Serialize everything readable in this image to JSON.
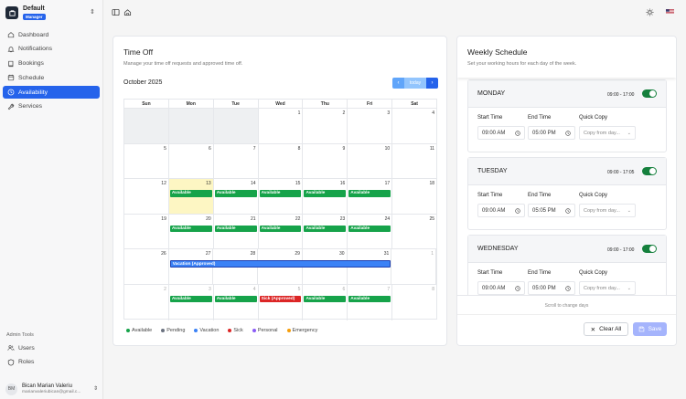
{
  "brand": {
    "name": "Default",
    "badge": "Manager"
  },
  "nav": [
    {
      "label": "Dashboard",
      "icon": "home-icon"
    },
    {
      "label": "Notifications",
      "icon": "bell-icon"
    },
    {
      "label": "Bookings",
      "icon": "book-icon"
    },
    {
      "label": "Schedule",
      "icon": "calendar-icon"
    },
    {
      "label": "Availability",
      "icon": "clock-icon",
      "active": true
    },
    {
      "label": "Services",
      "icon": "wrench-icon"
    }
  ],
  "admin": {
    "label": "Admin Tools",
    "items": [
      {
        "label": "Users",
        "icon": "users-icon"
      },
      {
        "label": "Roles",
        "icon": "shield-icon"
      }
    ]
  },
  "user": {
    "initials": "BM",
    "name": "Bican Marian Valeriu",
    "email": "marianvaleriubican@gmail.c..."
  },
  "timeoff": {
    "title": "Time Off",
    "subtitle": "Manage your time off requests and approved time off.",
    "month": "October 2025",
    "today_label": "today",
    "weekdays": [
      "Sun",
      "Mon",
      "Tue",
      "Wed",
      "Thu",
      "Fri",
      "Sat"
    ],
    "weeks": [
      [
        {
          "d": "",
          "g": true
        },
        {
          "d": "",
          "g": true
        },
        {
          "d": "",
          "g": true
        },
        {
          "d": "1"
        },
        {
          "d": "2"
        },
        {
          "d": "3"
        },
        {
          "d": "4"
        }
      ],
      [
        {
          "d": "5"
        },
        {
          "d": "6"
        },
        {
          "d": "7"
        },
        {
          "d": "8"
        },
        {
          "d": "9"
        },
        {
          "d": "10"
        },
        {
          "d": "11"
        }
      ],
      [
        {
          "d": "12"
        },
        {
          "d": "13",
          "today": true,
          "ev": "Available",
          "c": "green"
        },
        {
          "d": "14",
          "ev": "Available",
          "c": "green"
        },
        {
          "d": "15",
          "ev": "Available",
          "c": "green"
        },
        {
          "d": "16",
          "ev": "Available",
          "c": "green"
        },
        {
          "d": "17",
          "ev": "Available",
          "c": "green"
        },
        {
          "d": "18"
        }
      ],
      [
        {
          "d": "19"
        },
        {
          "d": "20",
          "ev": "Available",
          "c": "green"
        },
        {
          "d": "21",
          "ev": "Available",
          "c": "green"
        },
        {
          "d": "22",
          "ev": "Available",
          "c": "green"
        },
        {
          "d": "23",
          "ev": "Available",
          "c": "green"
        },
        {
          "d": "24",
          "ev": "Available",
          "c": "green"
        },
        {
          "d": "25"
        }
      ],
      [
        {
          "d": "26"
        },
        {
          "d": "27"
        },
        {
          "d": "28"
        },
        {
          "d": "29"
        },
        {
          "d": "30"
        },
        {
          "d": "31"
        },
        {
          "d": "1",
          "dim": true
        }
      ],
      [
        {
          "d": "2",
          "dim": true
        },
        {
          "d": "3",
          "dim": true,
          "ev": "Available",
          "c": "green"
        },
        {
          "d": "4",
          "dim": true,
          "ev": "Available",
          "c": "green"
        },
        {
          "d": "5",
          "dim": true,
          "ev": "Sick (Approved)",
          "c": "red"
        },
        {
          "d": "6",
          "dim": true,
          "ev": "Available",
          "c": "green"
        },
        {
          "d": "7",
          "dim": true,
          "ev": "Available",
          "c": "green"
        },
        {
          "d": "8",
          "dim": true
        }
      ]
    ],
    "vacation_event": "Vacation (Approved)",
    "legend": [
      {
        "label": "Available",
        "color": "#16a34a"
      },
      {
        "label": "Pending",
        "color": "#6b7280"
      },
      {
        "label": "Vacation",
        "color": "#3b82f6"
      },
      {
        "label": "Sick",
        "color": "#dc2626"
      },
      {
        "label": "Personal",
        "color": "#8b5cf6"
      },
      {
        "label": "Emergency",
        "color": "#f59e0b"
      }
    ]
  },
  "weekly": {
    "title": "Weekly Schedule",
    "subtitle": "Set your working hours for each day of the week.",
    "start_label": "Start Time",
    "end_label": "End Time",
    "copy_label": "Quick Copy",
    "copy_placeholder": "Copy from day...",
    "days": [
      {
        "name": "MONDAY",
        "range": "09:00 - 17:00",
        "start": "09:00 AM",
        "end": "05:00 PM"
      },
      {
        "name": "TUESDAY",
        "range": "09:00 - 17:05",
        "start": "09:00 AM",
        "end": "05:05 PM"
      },
      {
        "name": "WEDNESDAY",
        "range": "09:00 - 17:00",
        "start": "09:00 AM",
        "end": "05:00 PM"
      }
    ],
    "scroll_hint": "Scroll to change days",
    "clear_label": "Clear All",
    "save_label": "Save"
  }
}
